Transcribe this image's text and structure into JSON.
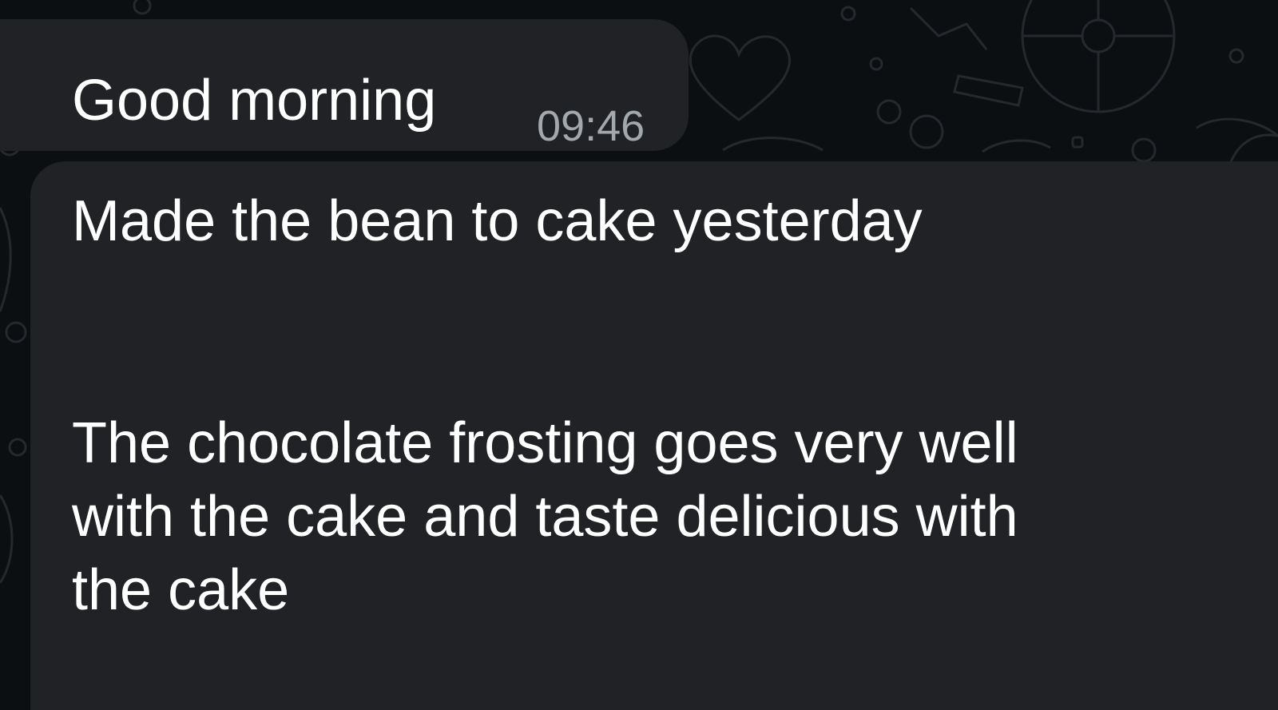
{
  "messages": [
    {
      "text": "Good morning",
      "time": "09:46"
    },
    {
      "lines": [
        "Made the bean to cake yesterday",
        "The chocolate frosting goes very well",
        "with the cake and taste delicious with",
        "the cake"
      ]
    }
  ],
  "colors": {
    "wallpaper": "#0c0f11",
    "bubble": "#202225",
    "text": "#ffffff",
    "timestamp": "#a3a8ad"
  },
  "icons": [
    "wallpaper-heart-icon",
    "wallpaper-wheel-icon",
    "wallpaper-circle-icon"
  ]
}
